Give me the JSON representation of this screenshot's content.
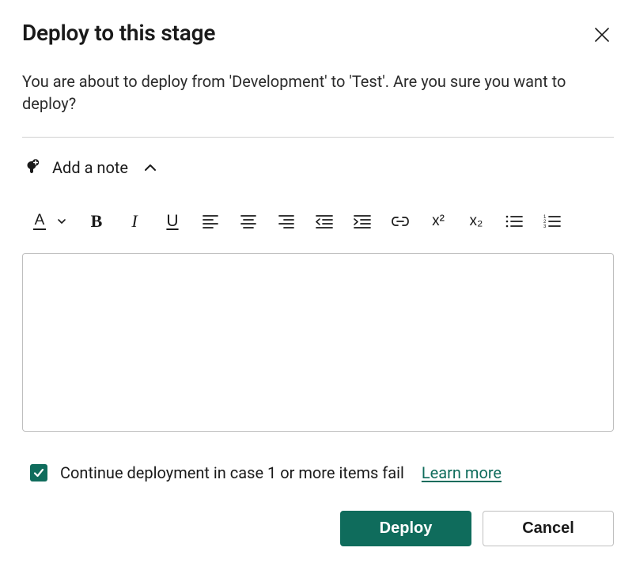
{
  "dialog": {
    "title": "Deploy to this stage",
    "description": "You are about to deploy from 'Development' to 'Test'. Are you sure you want to deploy?"
  },
  "note": {
    "label": "Add a note",
    "expanded": true,
    "value": ""
  },
  "toolbar": {
    "font_color_glyph": "A",
    "bold_glyph": "B",
    "italic_glyph": "I",
    "underline_glyph": "U",
    "superscript_glyph": "x²",
    "subscript_glyph": "x₂"
  },
  "continue_on_fail": {
    "checked": true,
    "label": "Continue deployment in case 1 or more items fail",
    "learn_more_label": "Learn more"
  },
  "actions": {
    "deploy_label": "Deploy",
    "cancel_label": "Cancel"
  },
  "colors": {
    "accent": "#0f6c5c"
  }
}
